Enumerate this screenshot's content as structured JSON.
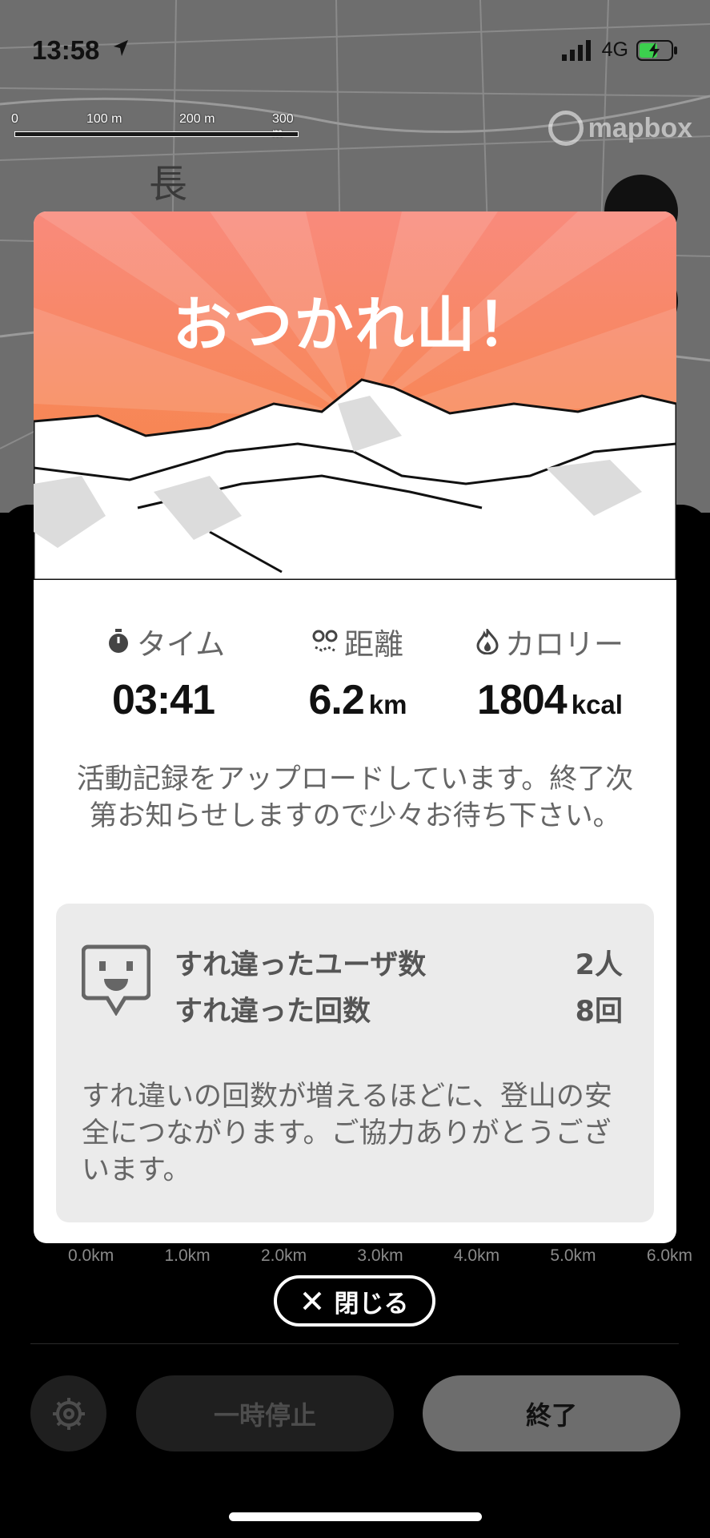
{
  "status_bar": {
    "time": "13:58",
    "network": "4G"
  },
  "map": {
    "scale_labels": [
      "0",
      "100 m",
      "200 m",
      "300 m"
    ],
    "attribution": "mapbox",
    "map_text": "長"
  },
  "modal": {
    "title": "おつかれ山！",
    "stats": [
      {
        "icon": "stopwatch-icon",
        "label": "タイム",
        "value": "03:41",
        "unit": ""
      },
      {
        "icon": "route-icon",
        "label": "距離",
        "value": "6.2",
        "unit": "km"
      },
      {
        "icon": "flame-icon",
        "label": "カロリー",
        "value": "1804",
        "unit": "kcal"
      }
    ],
    "upload_message": "活動記録をアップロードしています。終了次第お知らせしますので少々お待ち下さい。",
    "pass_by": {
      "users_label": "すれ違ったユーザ数",
      "users_value": "2人",
      "count_label": "すれ違った回数",
      "count_value": "8回",
      "note": "すれ違いの回数が増えるほどに、登山の安全につながります。ご協力ありがとうございます。"
    }
  },
  "elevation_axis": [
    "0.0km",
    "1.0km",
    "2.0km",
    "3.0km",
    "4.0km",
    "5.0km",
    "6.0km"
  ],
  "close_button": "閉じる",
  "controls": {
    "pause": "一時停止",
    "finish": "終了"
  },
  "colors": {
    "hero_top": "#f98a7c",
    "hero_bottom": "#f6843a"
  }
}
